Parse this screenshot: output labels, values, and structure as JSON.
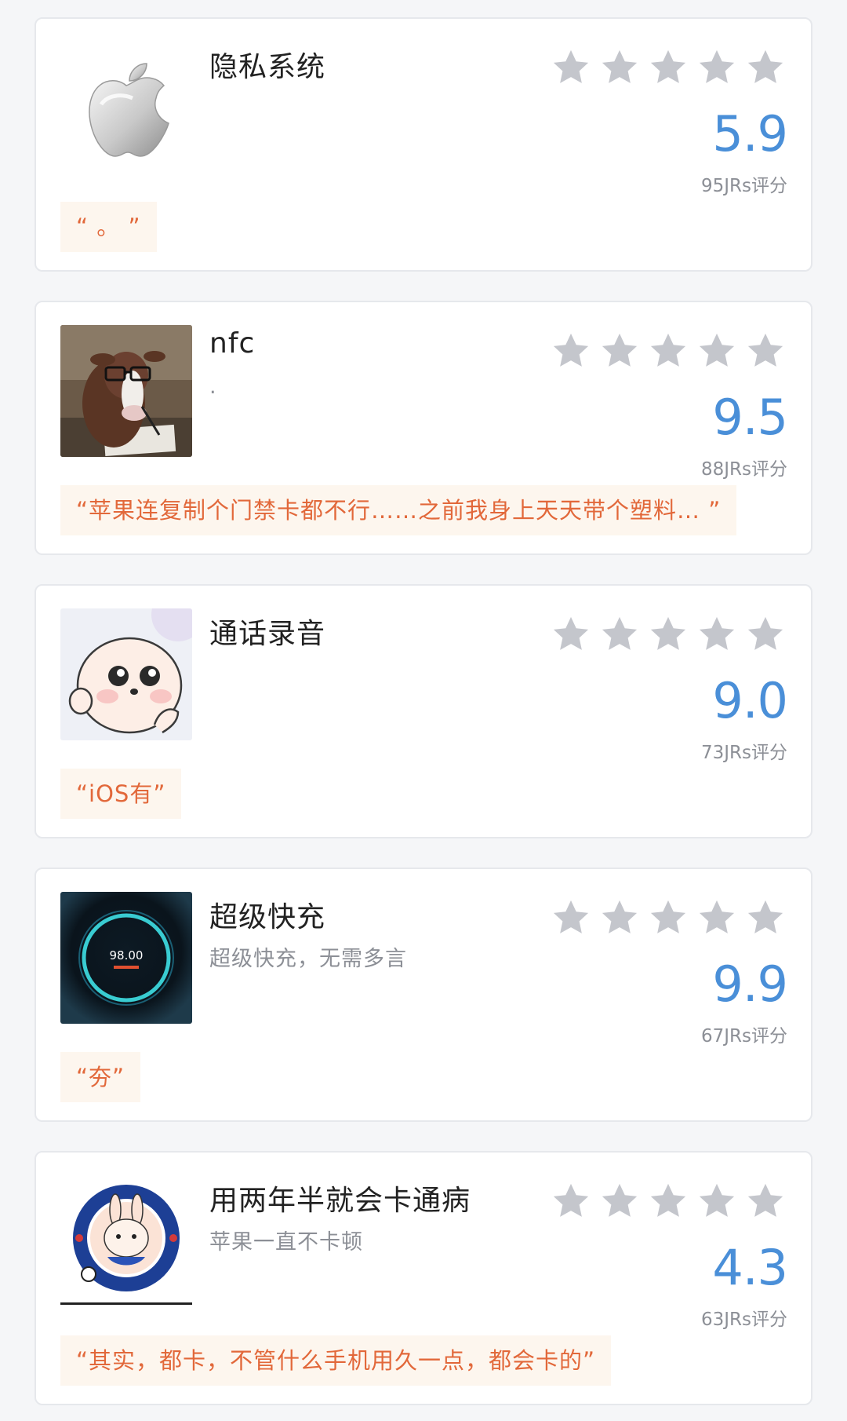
{
  "colors": {
    "accent_score": "#4a8fd8",
    "quote_text": "#e2683a",
    "quote_bg": "#fdf6ee",
    "star_inactive": "#c4c6cc"
  },
  "items": [
    {
      "title": "隐私系统",
      "subtitle": "",
      "thumbnail": "apple-logo",
      "stars_total": 5,
      "stars_filled": 0,
      "score": "5.9",
      "count": "95JRs评分",
      "quote": "“  。  ”"
    },
    {
      "title": "nfc",
      "subtitle": ".",
      "thumbnail": "cow-with-glasses",
      "stars_total": 5,
      "stars_filled": 0,
      "score": "9.5",
      "count": "88JRs评分",
      "quote": "“苹果连复制个门禁卡都不行……之前我身上天天带个塑料…  ”"
    },
    {
      "title": "通话录音",
      "subtitle": "",
      "thumbnail": "cartoon-character",
      "stars_total": 5,
      "stars_filled": 0,
      "score": "9.0",
      "count": "73JRs评分",
      "quote": "“iOS有”"
    },
    {
      "title": "超级快充",
      "subtitle": "超级快充，无需多言",
      "thumbnail": "charging-ring",
      "stars_total": 5,
      "stars_filled": 0,
      "score": "9.9",
      "count": "67JRs评分",
      "quote": "“夯”"
    },
    {
      "title": "用两年半就会卡通病",
      "subtitle": "苹果一直不卡顿",
      "thumbnail": "chelsea-badge",
      "stars_total": 5,
      "stars_filled": 0,
      "score": "4.3",
      "count": "63JRs评分",
      "quote": "“其实，都卡，不管什么手机用久一点，都会卡的”"
    }
  ]
}
